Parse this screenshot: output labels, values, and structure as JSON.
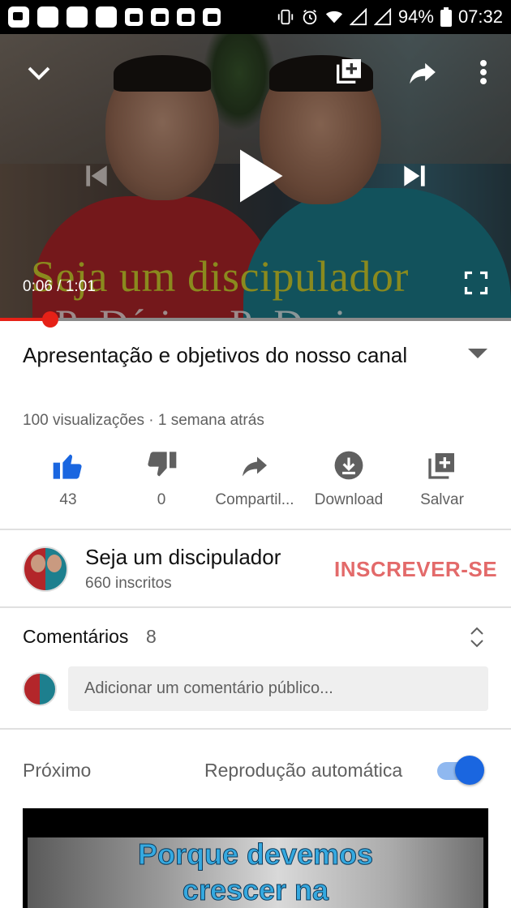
{
  "status_bar": {
    "battery": "94%",
    "time": "07:32"
  },
  "player": {
    "overlay_line1": "Seja um discipulador",
    "overlay_line2": "Pr.Dário e Pr.Dario",
    "current_time": "0:06",
    "duration": "1:01",
    "time_separator": " / ",
    "progress_fraction": 0.098
  },
  "video": {
    "title": "Apresentação e objetivos do nosso canal",
    "meta": "100 visualizações · 1 semana atrás"
  },
  "actions": [
    {
      "label": "43",
      "icon": "thumbs-up-icon"
    },
    {
      "label": "0",
      "icon": "thumbs-down-icon"
    },
    {
      "label": "Compartil...",
      "icon": "share-icon"
    },
    {
      "label": "Download",
      "icon": "download-icon"
    },
    {
      "label": "Salvar",
      "icon": "save-playlist-icon"
    }
  ],
  "channel": {
    "name": "Seja um discipulador",
    "subscribers": "660 inscritos",
    "subscribe_label": "INSCREVER-SE"
  },
  "comments": {
    "label": "Comentários",
    "count": "8",
    "placeholder": "Adicionar um comentário público..."
  },
  "up_next": {
    "label": "Próximo",
    "autoplay_label": "Reprodução automática",
    "autoplay_on": true,
    "thumb_line1": "Porque devemos",
    "thumb_line2": "crescer na"
  },
  "colors": {
    "accent_red": "#e62117",
    "like_blue": "#1a66e0",
    "subscribe_text": "#e36a6a"
  }
}
